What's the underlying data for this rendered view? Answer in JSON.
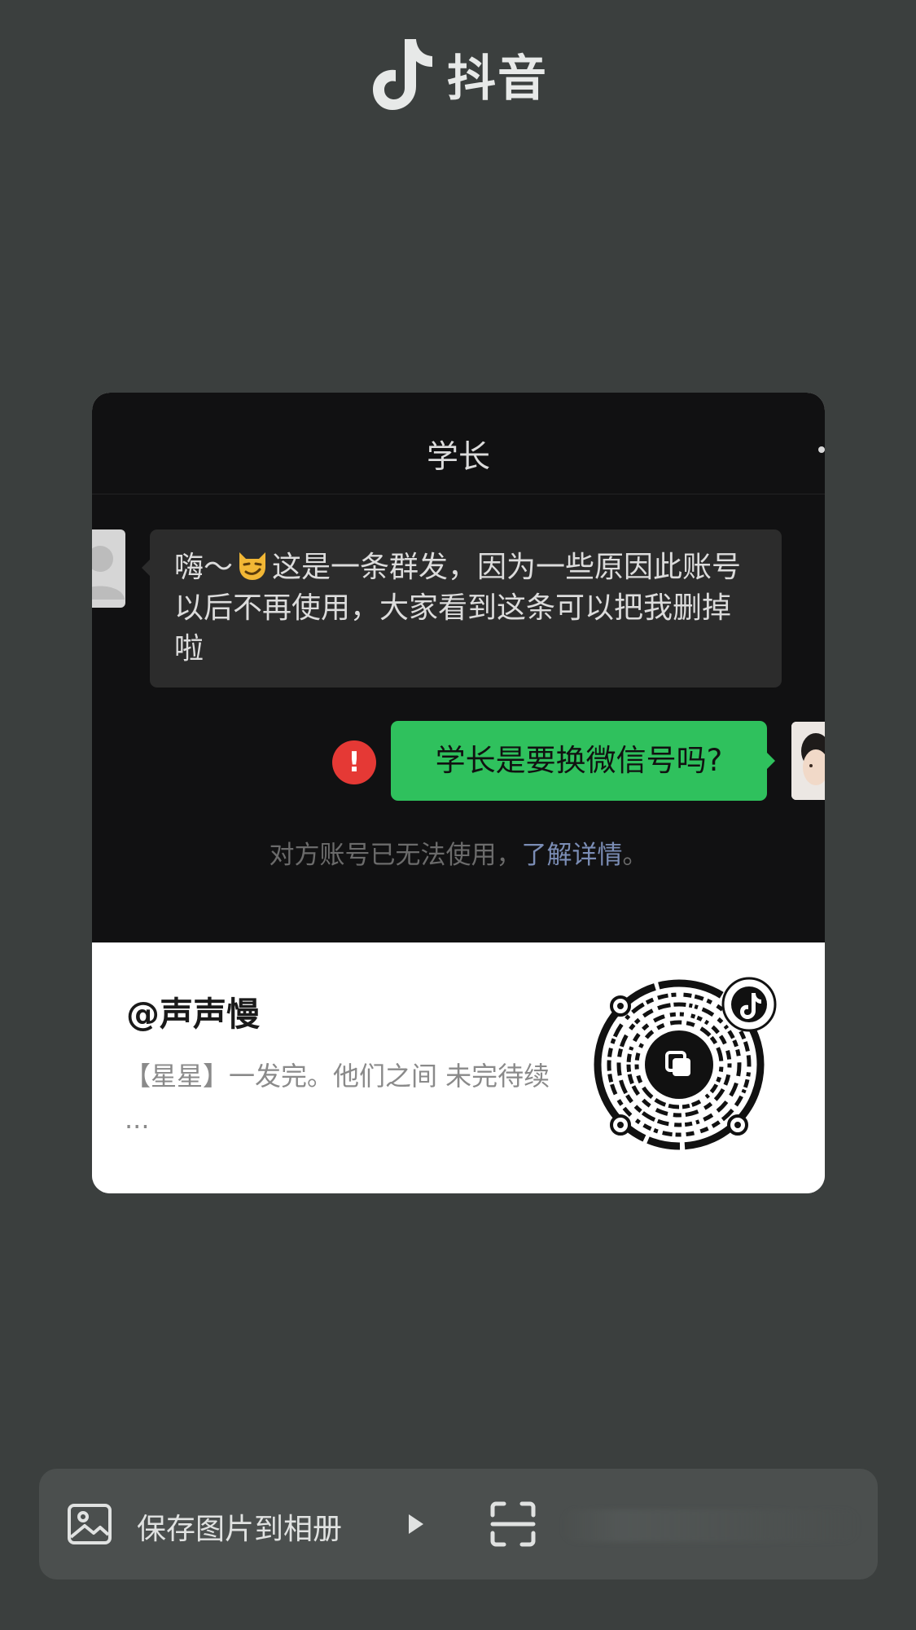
{
  "brand": {
    "name": "抖音",
    "logo_icon": "tiktok-note-icon"
  },
  "chat": {
    "title": "学长",
    "incoming": {
      "before_emoji": "嗨～",
      "emoji": "smirking-cat-emoji",
      "after_emoji": "这是一条群发，因为一些原因此账号以后不再使用，大家看到这条可以把我删掉啦"
    },
    "outgoing": {
      "text": "学长是要换微信号吗?",
      "status_icon": "error-icon",
      "status_glyph": "!"
    },
    "system": {
      "text": "对方账号已无法使用，",
      "link": "了解详情",
      "end": "。"
    }
  },
  "share": {
    "handle": "@声声慢",
    "description": "【星星】一发完。他们之间 未完待续 ..."
  },
  "actions": {
    "save_label": "保存图片到相册",
    "save_icon": "image-icon",
    "next_icon": "play-triangle-icon",
    "scan_icon": "scan-icon"
  },
  "colors": {
    "background": "#3b3f3e",
    "chat_bg": "#111112",
    "incoming_bubble": "#2c2c2c",
    "outgoing_bubble": "#2fc15d",
    "error": "#e53935",
    "link": "#7b8db5"
  }
}
